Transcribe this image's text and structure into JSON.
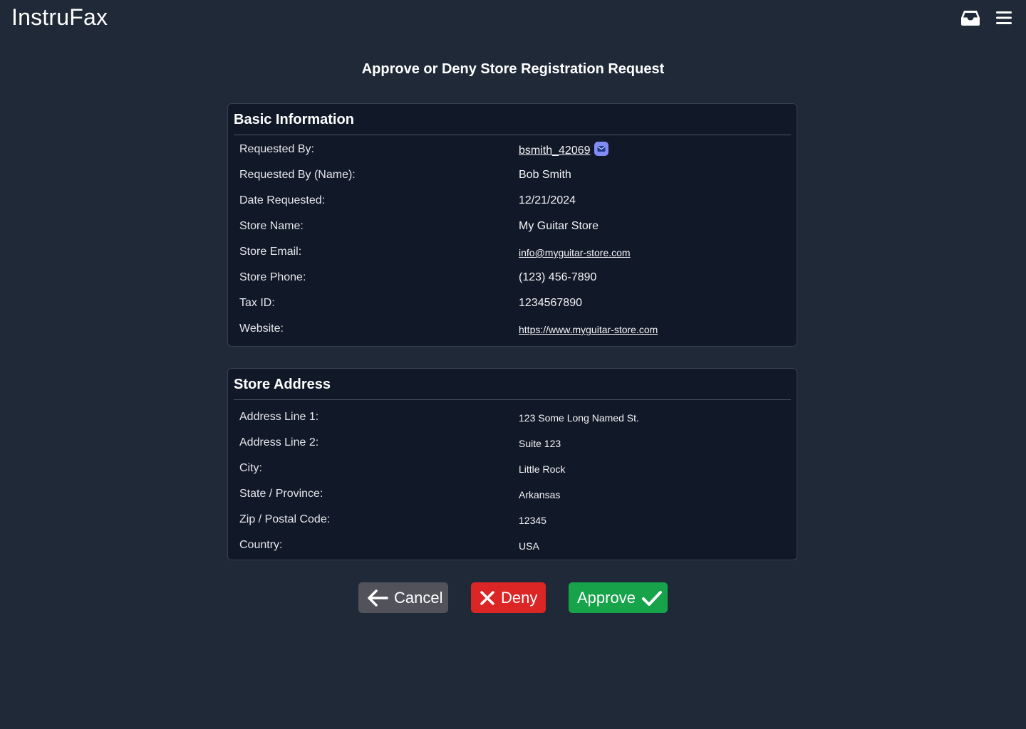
{
  "app": {
    "brand": "InstruFax",
    "icons": {
      "inbox": "inbox-icon",
      "menu": "hamburger-menu-icon"
    }
  },
  "page": {
    "title": "Approve or Deny Store Registration Request"
  },
  "basic_info": {
    "heading": "Basic Information",
    "requested_by_label": "Requested By:",
    "requested_by": "bsmith_42069",
    "requested_by_name_label": "Requested By (Name):",
    "requested_by_name": "Bob Smith",
    "date_requested_label": "Date Requested:",
    "date_requested": "12/21/2024",
    "store_name_label": "Store Name:",
    "store_name": "My Guitar Store",
    "store_email_label": "Store Email:",
    "store_email": "info@myguitar-store.com",
    "store_phone_label": "Store Phone:",
    "store_phone": "(123) 456-7890",
    "tax_id_label": "Tax ID:",
    "tax_id": "1234567890",
    "website_label": "Website:",
    "website": "https://www.myguitar-store.com"
  },
  "address": {
    "heading": "Store Address",
    "line1_label": "Address Line 1:",
    "line1": "123 Some Long Named St.",
    "line2_label": "Address Line 2:",
    "line2": "Suite 123",
    "city_label": "City:",
    "city": "Little Rock",
    "state_label": "State / Province:",
    "state": "Arkansas",
    "zip_label": "Zip / Postal Code:",
    "zip": "12345",
    "country_label": "Country:",
    "country": "USA"
  },
  "actions": {
    "cancel": "Cancel",
    "deny": "Deny",
    "approve": "Approve"
  },
  "colors": {
    "background": "#1f2937",
    "card": "#111827",
    "cancel": "#52525b",
    "deny": "#dc2626",
    "approve": "#16a34a",
    "mail_badge": "#818cf8"
  }
}
